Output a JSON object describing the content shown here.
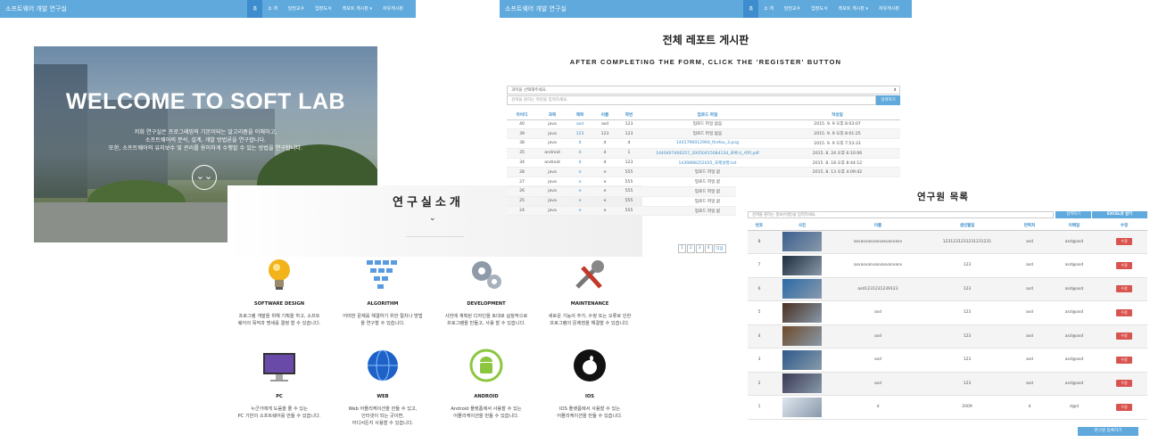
{
  "nav_left": {
    "brand": "소프트웨어 개발 연구실",
    "items": [
      "홈",
      "소 개",
      "담당교수",
      "업장도서",
      "레포트 게시판 ▾",
      "자유게시판"
    ]
  },
  "nav_right": {
    "brand": "소프트웨어 개발 연구실",
    "items": [
      "홈",
      "소 개",
      "담당교수",
      "업장도서",
      "레포트 게시판 ▾",
      "자유게시판"
    ]
  },
  "hero": {
    "title": "WELCOME TO SOFT LAB",
    "desc": [
      "저희 연구실은 프로그래밍의 기본이되는 알고리즘을 이해하고,",
      "소프트웨어의 분석, 설계, 개발 방법론을 연구합니다.",
      "또한, 소프트웨어의 유지보수 및 관리를 용이하게 수행할 수 있는 방법을 연구합니다."
    ]
  },
  "lab": {
    "title": "연구실소개",
    "chevron": "⌄",
    "items": [
      {
        "title": "SOFTWARE DESIGN",
        "desc": [
          "프로그램 개발을 위해 기획을 하고, 소프트",
          "웨어의 목적과 명세를 결정 할 수 있습니다."
        ]
      },
      {
        "title": "ALGORITHM",
        "desc": [
          "어떠한 문제를 해결하기 위한 절차나 방법",
          "을 연구할 수 있습니다."
        ]
      },
      {
        "title": "DEVELOPMENT",
        "desc": [
          "사전에 계획된 디자인을 토대로 실질적으로",
          "프로그램을 만들고, 사용 할 수 있습니다."
        ]
      },
      {
        "title": "MAINTENANCE",
        "desc": [
          "새로운 기능의 추가, 수정 또는 오류로 인한",
          "프로그램의 문제점을 해결할 수 있습니다."
        ]
      },
      {
        "title": "PC",
        "desc": [
          "누군가에게 도움을 줄 수 있는",
          "PC 기반의 소프트웨어를 만들 수 있습니다."
        ]
      },
      {
        "title": "WEB",
        "desc": [
          "Web 어플리케이션을 만들 수 있고,",
          "인터넷이 되는 곳이면,",
          "어디서든지 사용할 수 있습니다."
        ]
      },
      {
        "title": "ANDROID",
        "desc": [
          "Android 플랫폼에서 사용할 수 있는",
          "어플리케이션을 만들 수 있습니다."
        ]
      },
      {
        "title": "IOS",
        "desc": [
          "IOS 플랫폼에서 사용할 수 있는",
          "어플리케이션을 만들 수 있습니다."
        ]
      }
    ]
  },
  "board": {
    "title": "전체 레포트 게시판",
    "subtitle": "AFTER COMPLETING THE FORM, CLICK THE 'REGISTER' BUTTON",
    "select": "과목을 선택해주세요.",
    "search_placeholder": "검색을 원하는 학번을 입력하세요.",
    "search_btn": "검색하기",
    "headers": [
      "아이디",
      "과목",
      "제목",
      "이름",
      "학번",
      "업로드 파일",
      "작성일"
    ],
    "rows": [
      [
        "40",
        "java",
        "asd",
        "asd",
        "123",
        "업로드 파일 없음",
        "2015. 9. 9 오후 8:03:07"
      ],
      [
        "39",
        "java",
        "123",
        "123",
        "123",
        "업로드 파일 없음",
        "2015. 9. 9 오후 8:01:25"
      ],
      [
        "38",
        "java",
        "d",
        "d",
        "d",
        "1441796012994_firefox_3.png",
        "2015. 9. 9 오후 7:53:33"
      ],
      [
        "35",
        "android",
        "d",
        "d",
        "1",
        "1440407406257_20050415084134_프록시_서버.pdf",
        "2015. 8. 24 오후 6:10:06"
      ],
      [
        "34",
        "android",
        "d",
        "d",
        "123",
        "1439898252035_과제설명.txt",
        "2015. 8. 18 오후 8:44:12"
      ],
      [
        "28",
        "java",
        "e",
        "e",
        "555",
        "업로드 파일 없",
        "2015. 8. 13 오후 4:09:42"
      ],
      [
        "27",
        "java",
        "e",
        "e",
        "555",
        "업로드 파일 없",
        ""
      ],
      [
        "26",
        "java",
        "e",
        "e",
        "555",
        "업로드 파일 없",
        ""
      ],
      [
        "25",
        "java",
        "e",
        "e",
        "555",
        "업로드 파일 없",
        ""
      ],
      [
        "24",
        "java",
        "e",
        "e",
        "555",
        "업로드 파일 없",
        ""
      ]
    ],
    "pages": [
      "1",
      "2",
      "3",
      "4",
      "다음"
    ]
  },
  "members": {
    "title": "연구원 목록",
    "search_placeholder": "검색을 원하는 정보(이름)을 입력하세요.",
    "search_btn": "검색하기",
    "excel_btn": "EXCEL로 받기",
    "headers": [
      "번호",
      "사진",
      "이름",
      "생년월일",
      "연락처",
      "이메일",
      "수정"
    ],
    "rows": [
      [
        "8",
        "asvasvasvasvasvasvasv",
        "1231231231231231231",
        "asd",
        "asd@asd",
        "수정"
      ],
      [
        "7",
        "asvasvasvasvasvasvasv",
        "123",
        "asd",
        "asd@asd",
        "수정"
      ],
      [
        "6",
        "asd1231231239123",
        "123",
        "asd",
        "asd@asd",
        "수정"
      ],
      [
        "5",
        "asd",
        "123",
        "asd",
        "asd@asd",
        "수정"
      ],
      [
        "4",
        "asd",
        "123",
        "asd",
        "asd@asd",
        "수정"
      ],
      [
        "3",
        "asd",
        "123",
        "asd",
        "asd@asd",
        "수정"
      ],
      [
        "2",
        "asd",
        "123",
        "asd",
        "asd@asd",
        "수정"
      ],
      [
        "1",
        "d",
        "2009",
        "d",
        "d@d",
        "수정"
      ]
    ],
    "add_btn": "연구원 등록하기"
  },
  "colors": {
    "accent": "#5fa9dc",
    "danger": "#d9534f"
  }
}
